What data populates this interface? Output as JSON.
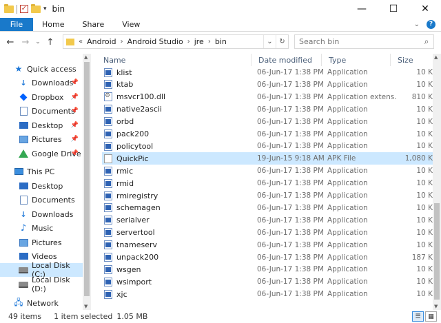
{
  "window": {
    "title": "bin"
  },
  "ribbon": {
    "tabs": [
      "File",
      "Home",
      "Share",
      "View"
    ]
  },
  "address": {
    "crumbs": [
      "Android",
      "Android Studio",
      "jre",
      "bin"
    ]
  },
  "search": {
    "placeholder": "Search bin"
  },
  "sidebar": {
    "items": [
      {
        "label": "Quick access",
        "icon": "star-icon",
        "pinned": false
      },
      {
        "label": "Downloads",
        "icon": "download-icon",
        "pinned": true
      },
      {
        "label": "Dropbox",
        "icon": "dropbox-icon",
        "pinned": true
      },
      {
        "label": "Documents",
        "icon": "documents-icon",
        "pinned": true
      },
      {
        "label": "Desktop",
        "icon": "desktop-icon",
        "pinned": true
      },
      {
        "label": "Pictures",
        "icon": "pictures-icon",
        "pinned": true
      },
      {
        "label": "Google Drive",
        "icon": "google-drive-icon",
        "pinned": true
      },
      {
        "label": "This PC",
        "icon": "computer-icon",
        "pinned": false
      },
      {
        "label": "Desktop",
        "icon": "desktop-icon",
        "pinned": false
      },
      {
        "label": "Documents",
        "icon": "documents-icon",
        "pinned": false
      },
      {
        "label": "Downloads",
        "icon": "download-icon",
        "pinned": false
      },
      {
        "label": "Music",
        "icon": "music-icon",
        "pinned": false
      },
      {
        "label": "Pictures",
        "icon": "pictures-icon",
        "pinned": false
      },
      {
        "label": "Videos",
        "icon": "videos-icon",
        "pinned": false
      },
      {
        "label": "Local Disk (C:)",
        "icon": "disk-icon",
        "pinned": false,
        "selected": true
      },
      {
        "label": "Local Disk (D:)",
        "icon": "disk-icon",
        "pinned": false
      },
      {
        "label": "Network",
        "icon": "network-icon",
        "pinned": false
      }
    ]
  },
  "columns": {
    "name": "Name",
    "date": "Date modified",
    "type": "Type",
    "size": "Size"
  },
  "files": [
    {
      "name": "klist",
      "date": "06-Jun-17 1:38 PM",
      "type": "Application",
      "size": "10 K",
      "icon": "app"
    },
    {
      "name": "ktab",
      "date": "06-Jun-17 1:38 PM",
      "type": "Application",
      "size": "10 K",
      "icon": "app"
    },
    {
      "name": "msvcr100.dll",
      "date": "06-Jun-17 1:38 PM",
      "type": "Application extens...",
      "size": "810 K",
      "icon": "dll"
    },
    {
      "name": "native2ascii",
      "date": "06-Jun-17 1:38 PM",
      "type": "Application",
      "size": "10 K",
      "icon": "app"
    },
    {
      "name": "orbd",
      "date": "06-Jun-17 1:38 PM",
      "type": "Application",
      "size": "10 K",
      "icon": "app"
    },
    {
      "name": "pack200",
      "date": "06-Jun-17 1:38 PM",
      "type": "Application",
      "size": "10 K",
      "icon": "app"
    },
    {
      "name": "policytool",
      "date": "06-Jun-17 1:38 PM",
      "type": "Application",
      "size": "10 K",
      "icon": "app"
    },
    {
      "name": "QuickPic",
      "date": "19-Jun-15 9:18 AM",
      "type": "APK File",
      "size": "1,080 K",
      "icon": "blank",
      "selected": true
    },
    {
      "name": "rmic",
      "date": "06-Jun-17 1:38 PM",
      "type": "Application",
      "size": "10 K",
      "icon": "app"
    },
    {
      "name": "rmid",
      "date": "06-Jun-17 1:38 PM",
      "type": "Application",
      "size": "10 K",
      "icon": "app"
    },
    {
      "name": "rmiregistry",
      "date": "06-Jun-17 1:38 PM",
      "type": "Application",
      "size": "10 K",
      "icon": "app"
    },
    {
      "name": "schemagen",
      "date": "06-Jun-17 1:38 PM",
      "type": "Application",
      "size": "10 K",
      "icon": "app"
    },
    {
      "name": "serialver",
      "date": "06-Jun-17 1:38 PM",
      "type": "Application",
      "size": "10 K",
      "icon": "app"
    },
    {
      "name": "servertool",
      "date": "06-Jun-17 1:38 PM",
      "type": "Application",
      "size": "10 K",
      "icon": "app"
    },
    {
      "name": "tnameserv",
      "date": "06-Jun-17 1:38 PM",
      "type": "Application",
      "size": "10 K",
      "icon": "app"
    },
    {
      "name": "unpack200",
      "date": "06-Jun-17 1:38 PM",
      "type": "Application",
      "size": "187 K",
      "icon": "app"
    },
    {
      "name": "wsgen",
      "date": "06-Jun-17 1:38 PM",
      "type": "Application",
      "size": "10 K",
      "icon": "app"
    },
    {
      "name": "wsimport",
      "date": "06-Jun-17 1:38 PM",
      "type": "Application",
      "size": "10 K",
      "icon": "app"
    },
    {
      "name": "xjc",
      "date": "06-Jun-17 1:38 PM",
      "type": "Application",
      "size": "10 K",
      "icon": "app"
    }
  ],
  "status": {
    "count": "49 items",
    "selected": "1 item selected",
    "size": "1.05 MB"
  },
  "colors": {
    "accent": "#1979ca",
    "selection": "#cce8ff"
  }
}
